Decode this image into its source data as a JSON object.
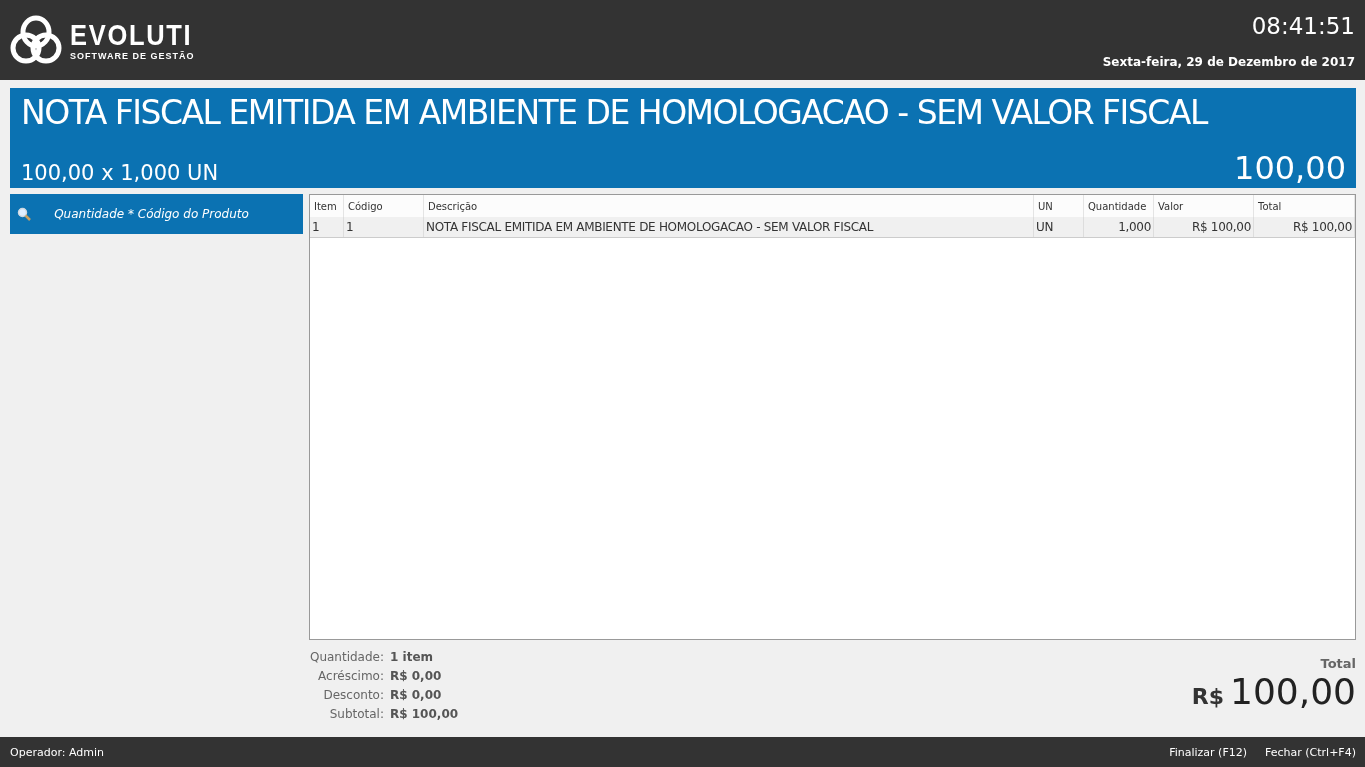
{
  "header": {
    "brand": "EVOLUTI",
    "tagline": "SOFTWARE DE GESTÃO",
    "time": "08:41:51",
    "date": "Sexta-feira, 29 de Dezembro de 2017"
  },
  "banner": {
    "product": "NOTA FISCAL EMITIDA EM AMBIENTE DE HOMOLOGACAO - SEM VALOR FISCAL",
    "calculation": "100,00 x 1,000 UN",
    "amount": "100,00"
  },
  "search": {
    "placeholder": "Quantidade * Código do Produto"
  },
  "table": {
    "columns": [
      "Item",
      "Código",
      "Descrição",
      "UN",
      "Quantidade",
      "Valor",
      "Total"
    ],
    "rows": [
      [
        "1",
        "1",
        "NOTA FISCAL EMITIDA EM AMBIENTE DE HOMOLOGACAO - SEM VALOR FISCAL",
        "UN",
        "1,000",
        "R$ 100,00",
        "R$ 100,00"
      ]
    ]
  },
  "summary": [
    {
      "label": "Quantidade:",
      "value": "1 item"
    },
    {
      "label": "Acréscimo:",
      "value": "R$ 0,00"
    },
    {
      "label": "Desconto:",
      "value": "R$ 0,00"
    },
    {
      "label": "Subtotal:",
      "value": "R$ 100,00"
    }
  ],
  "total": {
    "label": "Total",
    "currency": "R$",
    "amount": "100,00"
  },
  "status_bar": {
    "operator": "Operador: Admin",
    "actions": [
      "Finalizar (F12)",
      "Fechar (Ctrl+F4)"
    ]
  }
}
